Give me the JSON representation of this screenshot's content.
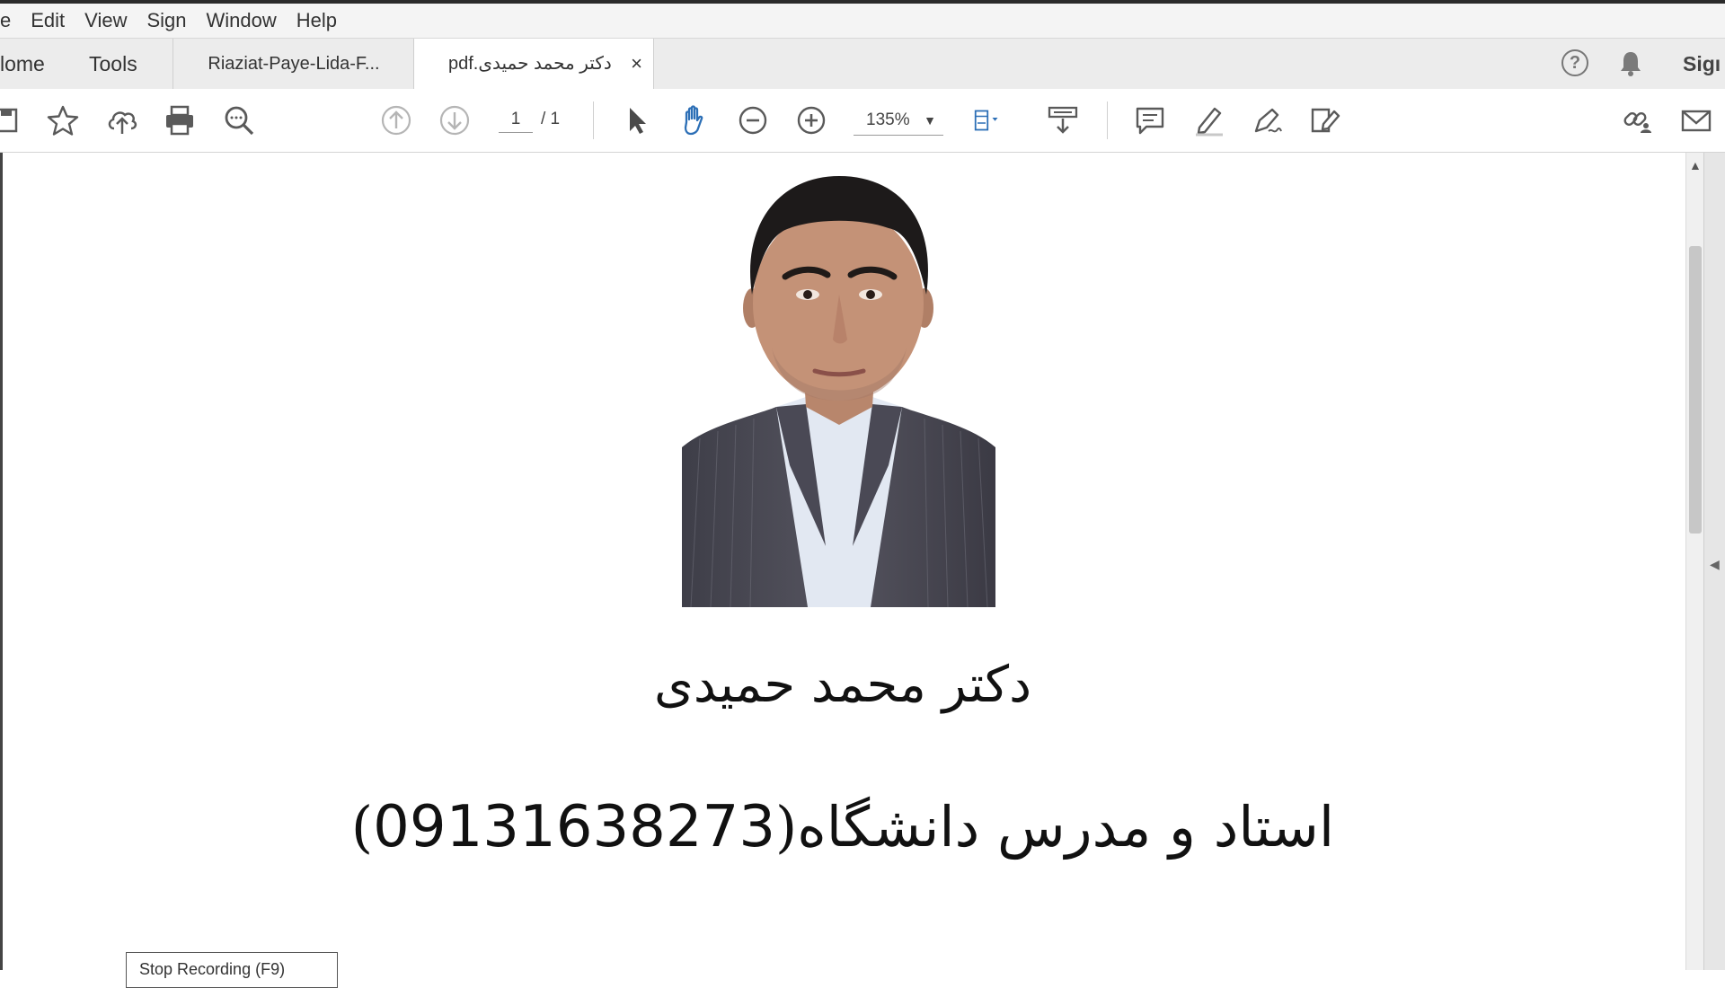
{
  "menu": [
    "e",
    "Edit",
    "View",
    "Sign",
    "Window",
    "Help"
  ],
  "tabs": {
    "home": "lome",
    "tools": "Tools",
    "doc1": "Riaziat-Paye-Lida-F...",
    "doc2": "pdf.دکتر محمد حمیدی",
    "close": "×",
    "sign": "Sigı"
  },
  "toolbar": {
    "page_current": "1",
    "page_total": "/ 1",
    "zoom": "135%"
  },
  "document": {
    "name": "دکتر محمد حمیدی",
    "title_text": "استاد و مدرس دانشگاه",
    "phone": "09131638273",
    "paren_open": "(",
    "paren_close": ")",
    "stop_button": "Stop Recording (F9)"
  },
  "colors": {
    "accent_blue": "#2c6fb6",
    "icon_gray": "#5a5a5a"
  }
}
